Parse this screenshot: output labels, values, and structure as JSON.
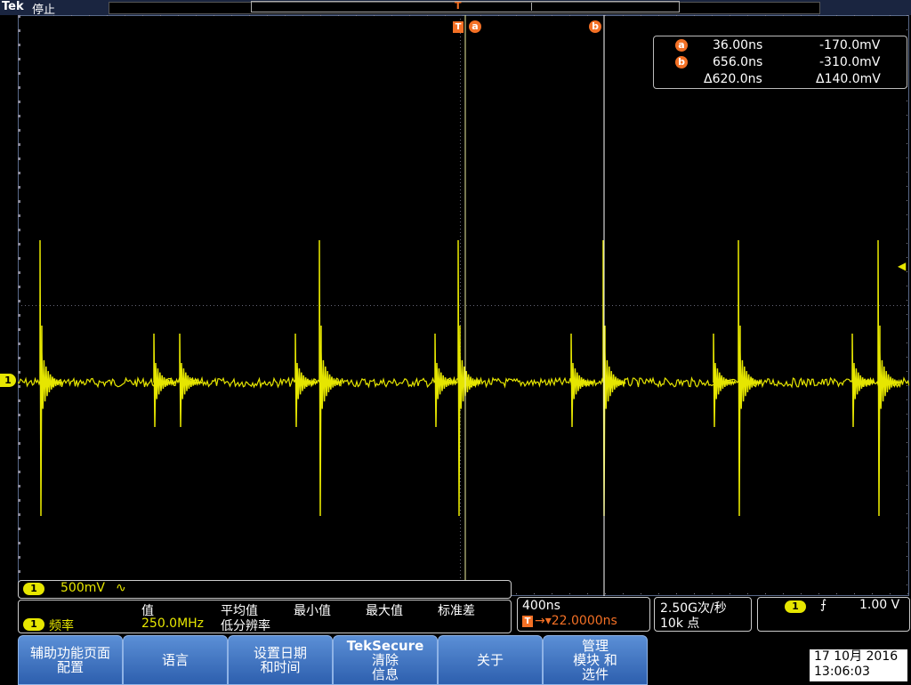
{
  "topbar": {
    "brand": "Tek",
    "state": "停止"
  },
  "cursor_markers": {
    "trigger": "T",
    "cursor_a": "a",
    "cursor_b": "b",
    "top_trigger_marker": "T"
  },
  "readout": {
    "a_label": "a",
    "a_time": "36.00ns",
    "a_volt": "-170.0mV",
    "b_label": "b",
    "b_time": "656.0ns",
    "b_volt": "-310.0mV",
    "delta_time": "Δ620.0ns",
    "delta_volt": "Δ140.0mV"
  },
  "channel_marker": "1",
  "channel_bar": {
    "ch": "1",
    "scale": "500mV",
    "coupling_icon": "∿"
  },
  "measurement": {
    "headers": [
      "值",
      "平均值",
      "最小值",
      "最大值",
      "标准差"
    ],
    "ch": "1",
    "name": "频率",
    "value": "250.0MHz",
    "note": "低分辨率"
  },
  "horizontal": {
    "scale": "400ns",
    "trigger_t": "T",
    "delay": "→▾22.0000ns"
  },
  "sampling": {
    "rate": "2.50G次/秒",
    "points": "10k 点"
  },
  "trigger": {
    "ch": "1",
    "slope_icon": "rising-edge-icon",
    "slope_glyph": "⨍",
    "level": "1.00 V"
  },
  "menu": {
    "btn1_l1": "辅助功能页面",
    "btn1_l2": "配置",
    "btn2": "语言",
    "btn3_l1": "设置日期",
    "btn3_l2": "和时间",
    "btn4_l1": "TekSecure",
    "btn4_l2": "清除",
    "btn4_l3": "信息",
    "btn5": "关于",
    "btn6_l1": "管理",
    "btn6_l2": "模块 和",
    "btn6_l3": "选件"
  },
  "datetime": {
    "date": "17 10月 2016",
    "time": "13:06:03"
  },
  "colors": {
    "trace": "#e6e600",
    "cursor": "#f37025",
    "menu": "#3a6cc0"
  }
}
